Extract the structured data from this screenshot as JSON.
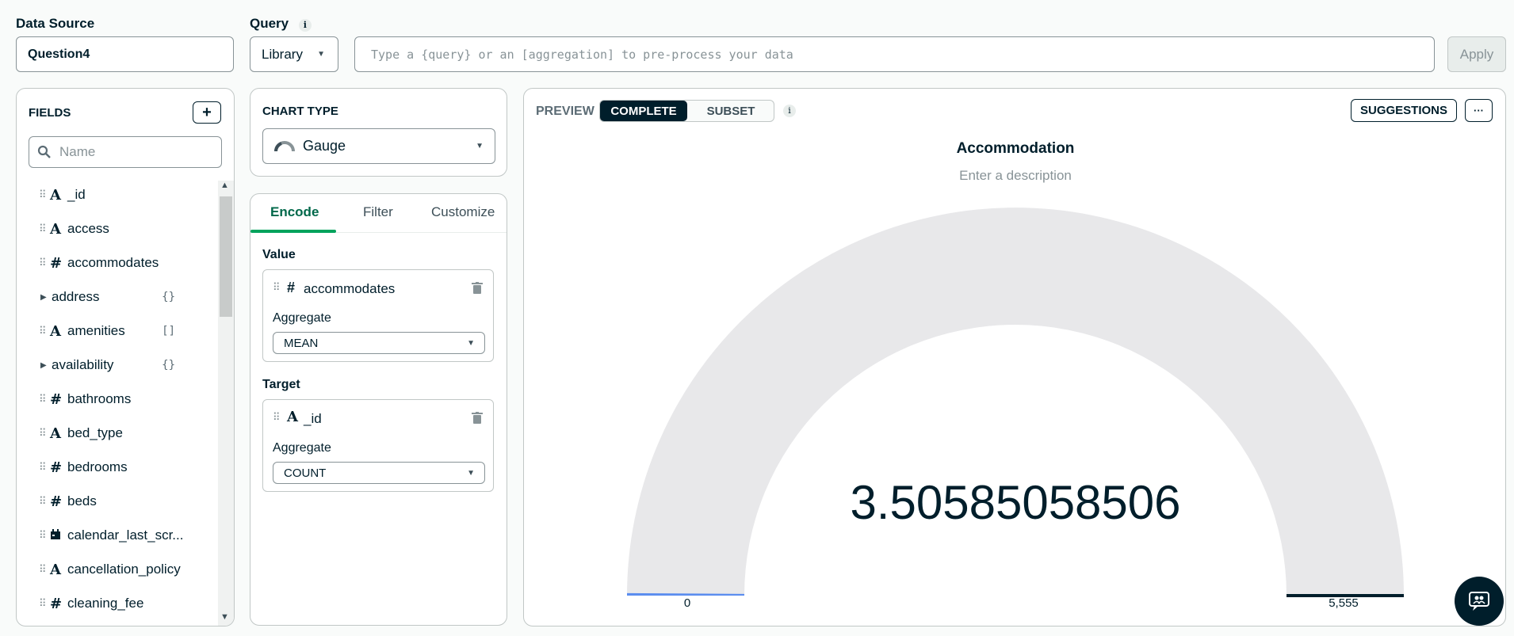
{
  "data_source": {
    "label": "Data Source",
    "value": "Question4"
  },
  "query": {
    "label": "Query",
    "mode": "Library",
    "placeholder": "Type a {query} or an [aggregation] to pre-process your data",
    "apply_label": "Apply"
  },
  "fields": {
    "title": "FIELDS",
    "search_placeholder": "Name",
    "items": [
      {
        "name": "_id",
        "type": "A",
        "expandable": false,
        "suffix": ""
      },
      {
        "name": "access",
        "type": "A",
        "expandable": false,
        "suffix": ""
      },
      {
        "name": "accommodates",
        "type": "#",
        "expandable": false,
        "suffix": ""
      },
      {
        "name": "address",
        "type": "",
        "expandable": true,
        "suffix": "{}"
      },
      {
        "name": "amenities",
        "type": "A",
        "expandable": false,
        "suffix": "[]"
      },
      {
        "name": "availability",
        "type": "",
        "expandable": true,
        "suffix": "{}"
      },
      {
        "name": "bathrooms",
        "type": "#",
        "expandable": false,
        "suffix": ""
      },
      {
        "name": "bed_type",
        "type": "A",
        "expandable": false,
        "suffix": ""
      },
      {
        "name": "bedrooms",
        "type": "#",
        "expandable": false,
        "suffix": ""
      },
      {
        "name": "beds",
        "type": "#",
        "expandable": false,
        "suffix": ""
      },
      {
        "name": "calendar_last_scr...",
        "type": "cal",
        "expandable": false,
        "suffix": ""
      },
      {
        "name": "cancellation_policy",
        "type": "A",
        "expandable": false,
        "suffix": ""
      },
      {
        "name": "cleaning_fee",
        "type": "#",
        "expandable": false,
        "suffix": ""
      }
    ]
  },
  "chart_type": {
    "label": "CHART TYPE",
    "value": "Gauge"
  },
  "encode_tabs": [
    "Encode",
    "Filter",
    "Customize"
  ],
  "encode": {
    "value_label": "Value",
    "value_field": "accommodates",
    "value_aggregate_label": "Aggregate",
    "value_aggregate": "MEAN",
    "target_label": "Target",
    "target_field": "_id",
    "target_aggregate_label": "Aggregate",
    "target_aggregate": "COUNT"
  },
  "preview": {
    "label": "PREVIEW",
    "mode_complete": "COMPLETE",
    "mode_subset": "SUBSET",
    "suggestions_label": "SUGGESTIONS",
    "more_label": "···"
  },
  "chart_data": {
    "type": "gauge",
    "title": "Accommodation",
    "description_placeholder": "Enter a description",
    "value": 3.50585058506,
    "value_text": "3.50585058506",
    "min": 0,
    "max": 5555,
    "min_label": "0",
    "max_label": "5,555"
  },
  "colors": {
    "accent": "#00684a",
    "dark": "#001e2b",
    "gauge_track": "#e8e8ea",
    "gauge_fill": "#5b8def"
  }
}
